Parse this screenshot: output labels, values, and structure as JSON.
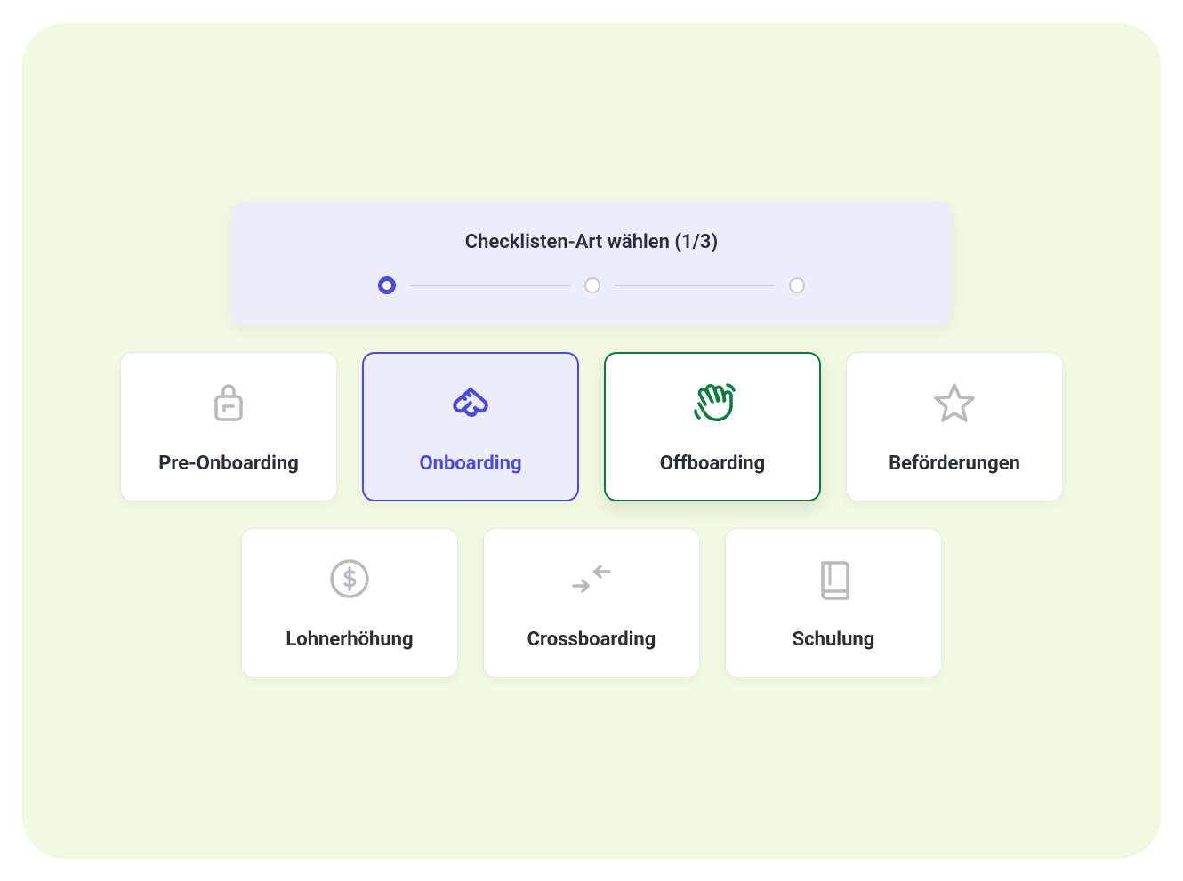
{
  "header": {
    "title": "Checklisten-Art wählen (1/3)",
    "steps_total": 3,
    "step_active": 1
  },
  "cards": {
    "pre_onboarding": {
      "label": "Pre-Onboarding"
    },
    "onboarding": {
      "label": "Onboarding"
    },
    "offboarding": {
      "label": "Offboarding"
    },
    "promotions": {
      "label": "Beförderungen"
    },
    "salary_increase": {
      "label": "Lohnerhöhung"
    },
    "crossboarding": {
      "label": "Crossboarding"
    },
    "training": {
      "label": "Schulung"
    }
  },
  "colors": {
    "accent": "#4a4ae0",
    "hover_border": "#0b7a3b",
    "panel_bg": "#edecfa",
    "canvas_bg": "#f1f9e1"
  }
}
